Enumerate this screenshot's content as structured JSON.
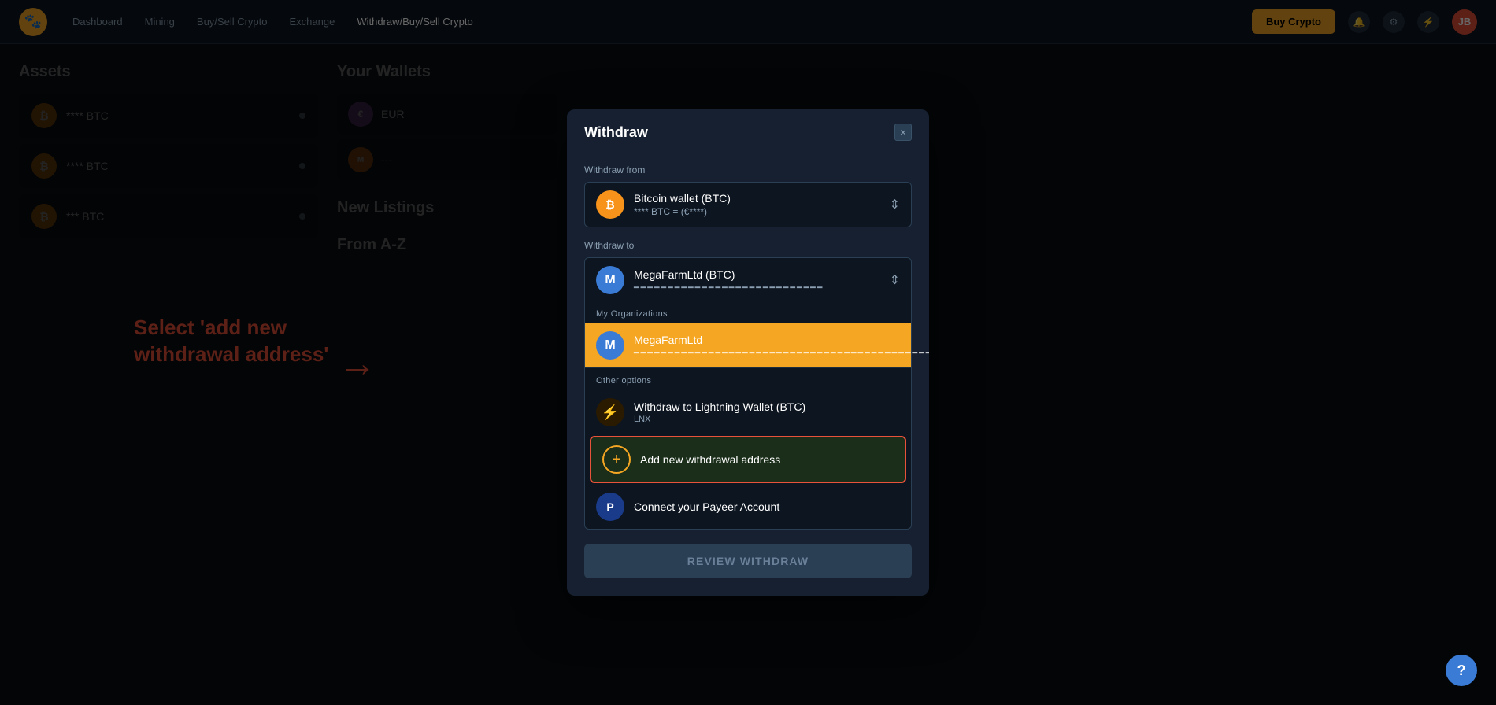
{
  "app": {
    "logo": "🐾",
    "nav": {
      "links": [
        {
          "label": "Dashboard",
          "active": false
        },
        {
          "label": "Mining",
          "active": false
        },
        {
          "label": "Buy/Sell Crypto",
          "active": false
        },
        {
          "label": "Exchange",
          "active": false
        },
        {
          "label": "Withdraw/Buy/Sell Crypto",
          "active": true
        }
      ],
      "buy_button": "Buy Crypto",
      "user_initials": "JB"
    }
  },
  "page": {
    "assets_title": "Assets",
    "wallets_title": "Your Wallets",
    "new_listings_title": "New Listings",
    "from_az_title": "From A-Z",
    "btc_label": "**** BTC",
    "btc_label2": "**** BTC",
    "btc_label3": "*** BTC"
  },
  "annotation": {
    "text": "Select 'add new\nwithdrawal address'",
    "arrow": "→"
  },
  "modal": {
    "title": "Withdraw",
    "close_label": "×",
    "withdraw_from_label": "Withdraw from",
    "withdraw_to_label": "Withdraw to",
    "from_wallet": {
      "name": "Bitcoin wallet (BTC)",
      "sub": "**** BTC = (€****)"
    },
    "to_wallet": {
      "name": "MegaFarmLtd (BTC)",
      "sub": "••••••••••••••••••••••••••••••••"
    },
    "dropdown": {
      "my_orgs_label": "My Organizations",
      "selected_item": {
        "name": "MegaFarmLtd",
        "sub": "••••••••••••••••••••••••••••••••••••••"
      },
      "other_options_label": "Other options",
      "items": [
        {
          "id": "lightning",
          "name": "Withdraw to Lightning Wallet (BTC)",
          "sub": "LNX",
          "icon_type": "lightning"
        },
        {
          "id": "add_new",
          "name": "Add new withdrawal address",
          "sub": "",
          "icon_type": "add"
        },
        {
          "id": "payeer",
          "name": "Connect your Payeer Account",
          "sub": "",
          "icon_type": "payeer"
        }
      ]
    },
    "review_button": "REVIEW WITHDRAW"
  },
  "help": {
    "label": "?"
  }
}
